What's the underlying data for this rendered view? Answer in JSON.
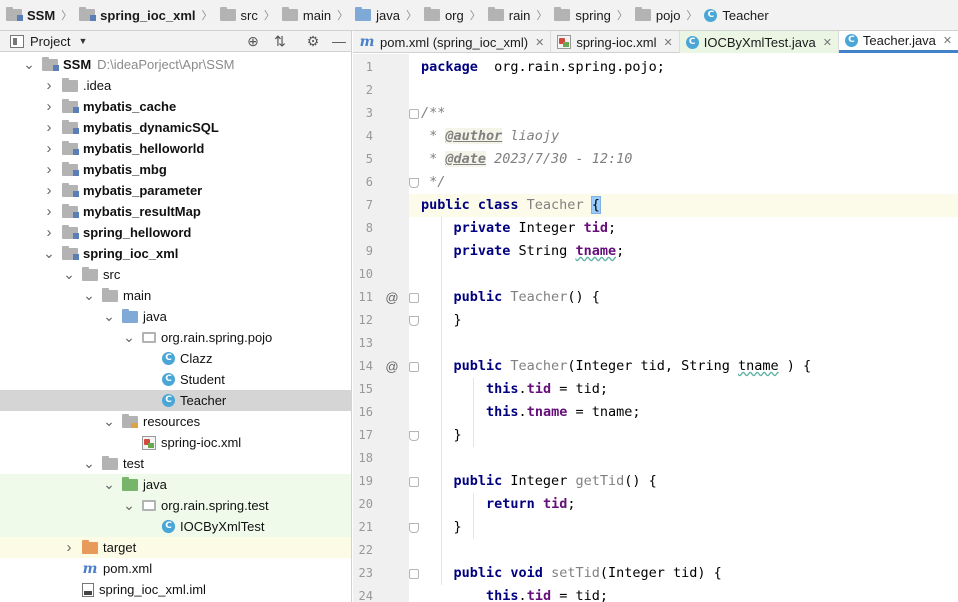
{
  "breadcrumb": [
    {
      "label": "SSM",
      "bold": true,
      "icon": "module-folder-icon"
    },
    {
      "label": "spring_ioc_xml",
      "bold": true,
      "icon": "module-folder-icon"
    },
    {
      "label": "src",
      "bold": false,
      "icon": "folder-icon"
    },
    {
      "label": "main",
      "bold": false,
      "icon": "folder-icon"
    },
    {
      "label": "java",
      "bold": false,
      "icon": "source-folder-icon"
    },
    {
      "label": "org",
      "bold": false,
      "icon": "package-icon"
    },
    {
      "label": "rain",
      "bold": false,
      "icon": "package-icon"
    },
    {
      "label": "spring",
      "bold": false,
      "icon": "package-icon"
    },
    {
      "label": "pojo",
      "bold": false,
      "icon": "package-icon"
    },
    {
      "label": "Teacher",
      "bold": false,
      "icon": "class-icon"
    }
  ],
  "project_panel": {
    "title": "Project",
    "tree": [
      {
        "label": "SSM",
        "path": "D:\\ideaPorject\\Apr\\SSM",
        "bold": true,
        "arrow": "down",
        "icon": "module",
        "indent": 0,
        "bg": ""
      },
      {
        "label": ".idea",
        "bold": false,
        "arrow": "right",
        "icon": "folder",
        "indent": 1,
        "bg": ""
      },
      {
        "label": "mybatis_cache",
        "bold": true,
        "arrow": "right",
        "icon": "module",
        "indent": 1,
        "bg": ""
      },
      {
        "label": "mybatis_dynamicSQL",
        "bold": true,
        "arrow": "right",
        "icon": "module",
        "indent": 1,
        "bg": ""
      },
      {
        "label": "mybatis_helloworld",
        "bold": true,
        "arrow": "right",
        "icon": "module",
        "indent": 1,
        "bg": ""
      },
      {
        "label": "mybatis_mbg",
        "bold": true,
        "arrow": "right",
        "icon": "module",
        "indent": 1,
        "bg": ""
      },
      {
        "label": "mybatis_parameter",
        "bold": true,
        "arrow": "right",
        "icon": "module",
        "indent": 1,
        "bg": ""
      },
      {
        "label": "mybatis_resultMap",
        "bold": true,
        "arrow": "right",
        "icon": "module",
        "indent": 1,
        "bg": ""
      },
      {
        "label": "spring_helloword",
        "bold": true,
        "arrow": "right",
        "icon": "module",
        "indent": 1,
        "bg": ""
      },
      {
        "label": "spring_ioc_xml",
        "bold": true,
        "arrow": "down",
        "icon": "module",
        "indent": 1,
        "bg": ""
      },
      {
        "label": "src",
        "bold": false,
        "arrow": "down",
        "icon": "folder",
        "indent": 2,
        "bg": ""
      },
      {
        "label": "main",
        "bold": false,
        "arrow": "down",
        "icon": "folder",
        "indent": 3,
        "bg": ""
      },
      {
        "label": "java",
        "bold": false,
        "arrow": "down",
        "icon": "folder-blue",
        "indent": 4,
        "bg": ""
      },
      {
        "label": "org.rain.spring.pojo",
        "bold": false,
        "arrow": "down",
        "icon": "package",
        "indent": 5,
        "bg": ""
      },
      {
        "label": "Clazz",
        "bold": false,
        "arrow": "",
        "icon": "class",
        "indent": 6,
        "bg": ""
      },
      {
        "label": "Student",
        "bold": false,
        "arrow": "",
        "icon": "class",
        "indent": 6,
        "bg": ""
      },
      {
        "label": "Teacher",
        "bold": false,
        "arrow": "",
        "icon": "class",
        "indent": 6,
        "bg": "selected"
      },
      {
        "label": "resources",
        "bold": false,
        "arrow": "down",
        "icon": "folder-res",
        "indent": 4,
        "bg": ""
      },
      {
        "label": "spring-ioc.xml",
        "bold": false,
        "arrow": "",
        "icon": "xml",
        "indent": 5,
        "bg": ""
      },
      {
        "label": "test",
        "bold": false,
        "arrow": "down",
        "icon": "folder",
        "indent": 3,
        "bg": ""
      },
      {
        "label": "java",
        "bold": false,
        "arrow": "down",
        "icon": "folder-green",
        "indent": 4,
        "bg": "test-bg"
      },
      {
        "label": "org.rain.spring.test",
        "bold": false,
        "arrow": "down",
        "icon": "package",
        "indent": 5,
        "bg": "test-bg"
      },
      {
        "label": "IOCByXmlTest",
        "bold": false,
        "arrow": "",
        "icon": "class-test",
        "indent": 6,
        "bg": "test-bg"
      },
      {
        "label": "target",
        "bold": false,
        "arrow": "right",
        "icon": "folder-orange",
        "indent": 2,
        "bg": "excl-bg"
      },
      {
        "label": "pom.xml",
        "bold": false,
        "arrow": "",
        "icon": "maven",
        "indent": 2,
        "bg": ""
      },
      {
        "label": "spring_ioc_xml.iml",
        "bold": false,
        "arrow": "",
        "icon": "iml",
        "indent": 2,
        "bg": ""
      }
    ]
  },
  "tabs": [
    {
      "label": "pom.xml (spring_ioc_xml)",
      "icon": "maven-icon",
      "active": false,
      "test": false
    },
    {
      "label": "spring-ioc.xml",
      "icon": "xml-icon",
      "active": false,
      "test": false
    },
    {
      "label": "IOCByXmlTest.java",
      "icon": "class-icon",
      "active": false,
      "test": true
    },
    {
      "label": "Teacher.java",
      "icon": "class-icon",
      "active": true,
      "test": false
    }
  ],
  "editor": {
    "current_line": 7,
    "lines": [
      {
        "n": "1",
        "ann": "",
        "fold": "",
        "tokens": [
          [
            "kw",
            "package"
          ],
          [
            "",
            "  org.rain.spring.pojo;"
          ]
        ]
      },
      {
        "n": "2",
        "ann": "",
        "fold": "",
        "tokens": []
      },
      {
        "n": "3",
        "ann": "",
        "fold": "start",
        "tokens": [
          [
            "cmt",
            "/**"
          ]
        ]
      },
      {
        "n": "4",
        "ann": "",
        "fold": "",
        "tokens": [
          [
            "cmt",
            " * "
          ],
          [
            "tag",
            "@author"
          ],
          [
            "cmt",
            " liaojy"
          ]
        ]
      },
      {
        "n": "5",
        "ann": "",
        "fold": "",
        "tokens": [
          [
            "cmt",
            " * "
          ],
          [
            "tag",
            "@date"
          ],
          [
            "cmt",
            " 2023/7/30 - 12:10"
          ]
        ]
      },
      {
        "n": "6",
        "ann": "",
        "fold": "end",
        "tokens": [
          [
            "cmt",
            " */"
          ]
        ]
      },
      {
        "n": "7",
        "ann": "",
        "fold": "",
        "tokens": [
          [
            "kw",
            "public class "
          ],
          [
            "unused",
            "Teacher "
          ],
          [
            "brace",
            "{"
          ]
        ]
      },
      {
        "n": "8",
        "ann": "",
        "fold": "",
        "tokens": [
          [
            "",
            "    "
          ],
          [
            "kw",
            "private "
          ],
          [
            "",
            "Integer "
          ],
          [
            "fld",
            "tid"
          ],
          [
            "",
            ";"
          ]
        ]
      },
      {
        "n": "9",
        "ann": "",
        "fold": "",
        "tokens": [
          [
            "",
            "    "
          ],
          [
            "kw",
            "private "
          ],
          [
            "",
            "String "
          ],
          [
            "fld wavy",
            "tname"
          ],
          [
            "",
            ";"
          ]
        ]
      },
      {
        "n": "10",
        "ann": "",
        "fold": "",
        "tokens": []
      },
      {
        "n": "11",
        "ann": "@",
        "fold": "start",
        "tokens": [
          [
            "",
            "    "
          ],
          [
            "kw",
            "public "
          ],
          [
            "unused",
            "Teacher"
          ],
          [
            "",
            "() {"
          ]
        ]
      },
      {
        "n": "12",
        "ann": "",
        "fold": "end",
        "tokens": [
          [
            "",
            "    }"
          ]
        ]
      },
      {
        "n": "13",
        "ann": "",
        "fold": "",
        "tokens": []
      },
      {
        "n": "14",
        "ann": "@",
        "fold": "start",
        "tokens": [
          [
            "",
            "    "
          ],
          [
            "kw",
            "public "
          ],
          [
            "unused",
            "Teacher"
          ],
          [
            "",
            "(Integer tid, String "
          ],
          [
            "wavy",
            "tname"
          ],
          [
            "",
            " ) {"
          ]
        ]
      },
      {
        "n": "15",
        "ann": "",
        "fold": "",
        "tokens": [
          [
            "",
            "        "
          ],
          [
            "kw",
            "this"
          ],
          [
            ".",
            ""
          ],
          [
            "fld",
            "tid"
          ],
          [
            "",
            " = tid;"
          ]
        ]
      },
      {
        "n": "16",
        "ann": "",
        "fold": "",
        "tokens": [
          [
            "",
            "        "
          ],
          [
            "kw",
            "this"
          ],
          [
            ".",
            ""
          ],
          [
            "fld",
            "tname"
          ],
          [
            "",
            " = tname;"
          ]
        ]
      },
      {
        "n": "17",
        "ann": "",
        "fold": "end",
        "tokens": [
          [
            "",
            "    }"
          ]
        ]
      },
      {
        "n": "18",
        "ann": "",
        "fold": "",
        "tokens": []
      },
      {
        "n": "19",
        "ann": "",
        "fold": "start",
        "tokens": [
          [
            "",
            "    "
          ],
          [
            "kw",
            "public "
          ],
          [
            "",
            "Integer "
          ],
          [
            "unused",
            "getTid"
          ],
          [
            "",
            "() {"
          ]
        ]
      },
      {
        "n": "20",
        "ann": "",
        "fold": "",
        "tokens": [
          [
            "",
            "        "
          ],
          [
            "kw",
            "return "
          ],
          [
            "fld",
            "tid"
          ],
          [
            "",
            ";"
          ]
        ]
      },
      {
        "n": "21",
        "ann": "",
        "fold": "end",
        "tokens": [
          [
            "",
            "    }"
          ]
        ]
      },
      {
        "n": "22",
        "ann": "",
        "fold": "",
        "tokens": []
      },
      {
        "n": "23",
        "ann": "",
        "fold": "start",
        "tokens": [
          [
            "",
            "    "
          ],
          [
            "kw",
            "public void "
          ],
          [
            "unused",
            "setTid"
          ],
          [
            "",
            "(Integer tid) {"
          ]
        ]
      },
      {
        "n": "24",
        "ann": "",
        "fold": "",
        "tokens": [
          [
            "",
            "        "
          ],
          [
            "kw",
            "this"
          ],
          [
            ".",
            ""
          ],
          [
            "fld",
            "tid"
          ],
          [
            "",
            " = tid;"
          ]
        ]
      }
    ]
  }
}
